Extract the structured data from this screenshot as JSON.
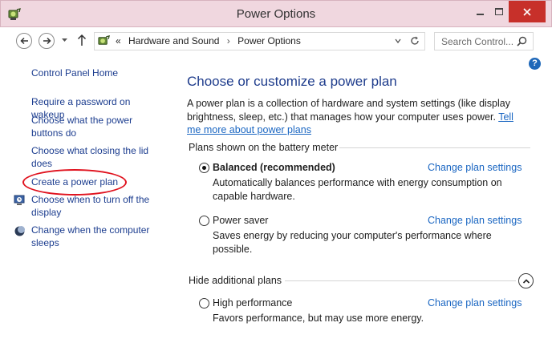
{
  "window": {
    "title": "Power Options"
  },
  "address_bar": {
    "overflow": "«",
    "crumbs": [
      "Hardware and Sound",
      "Power Options"
    ],
    "separator": "›"
  },
  "search": {
    "placeholder": "Search Control..."
  },
  "sidebar": {
    "home": "Control Panel Home",
    "links": [
      "Require a password on wakeup",
      "Choose what the power buttons do",
      "Choose what closing the lid does",
      "Create a power plan",
      "Choose when to turn off the display",
      "Change when the computer sleeps"
    ]
  },
  "main": {
    "title": "Choose or customize a power plan",
    "description": "A power plan is a collection of hardware and system settings (like display brightness, sleep, etc.) that manages how your computer uses power.",
    "tell_me_link": "Tell me more about power plans",
    "battery_group": "Plans shown on the battery meter",
    "additional_group": "Hide additional plans",
    "plans": [
      {
        "name": "Balanced (recommended)",
        "description": "Automatically balances performance with energy consumption on capable hardware.",
        "link": "Change plan settings",
        "selected": true
      },
      {
        "name": "Power saver",
        "description": "Saves energy by reducing your computer's performance where possible.",
        "link": "Change plan settings",
        "selected": false
      },
      {
        "name": "High performance",
        "description": "Favors performance, but may use more energy.",
        "link": "Change plan settings",
        "selected": false
      }
    ]
  },
  "colors": {
    "titlebar": "#f0d7df",
    "close_button": "#c7302a",
    "link_blue": "#1a66c2",
    "heading_blue": "#1e3c8c",
    "annotation_red": "#e0121e"
  },
  "icons": {
    "app": "power-options-icon",
    "help": "help-icon",
    "display_timer": "clock-icon",
    "sleep": "moon-icon"
  }
}
